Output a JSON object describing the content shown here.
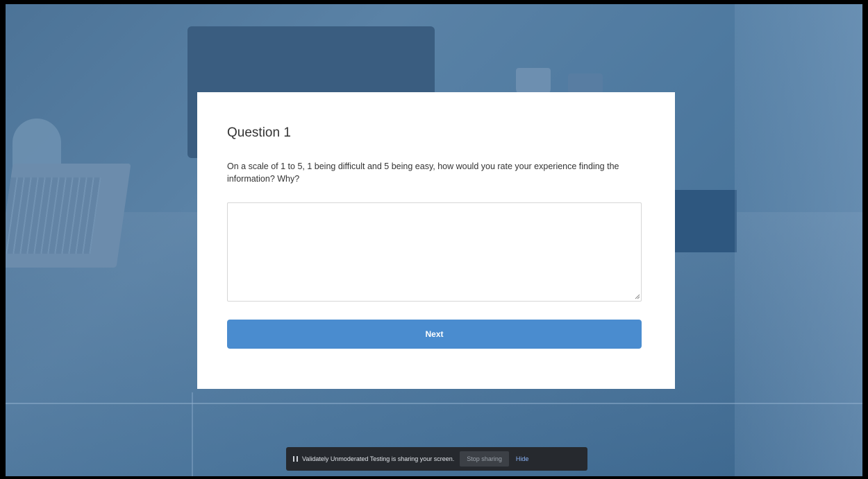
{
  "question": {
    "title": "Question 1",
    "text": "On a scale of 1 to 5, 1 being difficult and 5 being easy, how would you rate your experience finding the information? Why?",
    "answer_value": "",
    "next_label": "Next"
  },
  "share_bar": {
    "message": "Validately Unmoderated Testing is sharing your screen.",
    "stop_label": "Stop sharing",
    "hide_label": "Hide"
  },
  "colors": {
    "accent": "#4a8ccf",
    "share_bar_bg": "#26292e",
    "hide_link": "#8ab4f8"
  },
  "icons": {
    "pause": "pause-icon",
    "resize": "resize-grip-icon"
  }
}
